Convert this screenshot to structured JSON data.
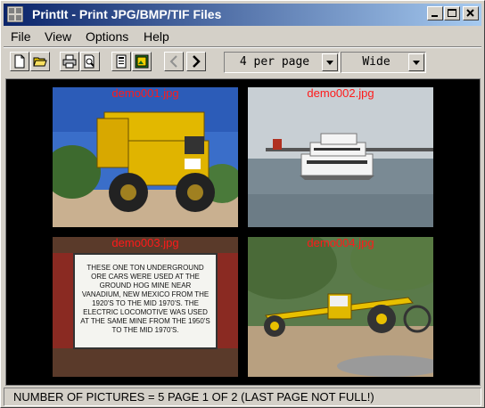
{
  "window": {
    "title": "PrintIt - Print JPG/BMP/TIF Files"
  },
  "menu": {
    "items": [
      "File",
      "View",
      "Options",
      "Help"
    ]
  },
  "toolbar": {
    "buttons": [
      "new-icon",
      "open-folder-icon",
      "printer-icon",
      "print-preview-icon",
      "page-setup-icon",
      "image-settings-icon",
      "previous-page-icon",
      "next-page-icon"
    ],
    "per_page": {
      "value": "4 per page"
    },
    "layout": {
      "value": "Wide"
    }
  },
  "thumbnails": [
    {
      "filename": "demo001.jpg",
      "subject": "yellow mining dump truck"
    },
    {
      "filename": "demo002.jpg",
      "subject": "white ferry boat on water"
    },
    {
      "filename": "demo003.jpg",
      "subject": "sign on red ore car"
    },
    {
      "filename": "demo004.jpg",
      "subject": "yellow road grader"
    }
  ],
  "sign_text": "THESE ONE TON UNDERGROUND ORE CARS WERE USED AT THE GROUND HOG MINE NEAR VANADIUM, NEW MEXICO FROM THE 1920'S TO THE MID 1970'S. THE ELECTRIC LOCOMOTIVE WAS USED AT THE SAME MINE FROM THE 1950'S TO THE MID 1970'S.",
  "status": {
    "text": "NUMBER OF PICTURES = 5    PAGE 1 OF 2    (LAST PAGE NOT FULL!)"
  }
}
